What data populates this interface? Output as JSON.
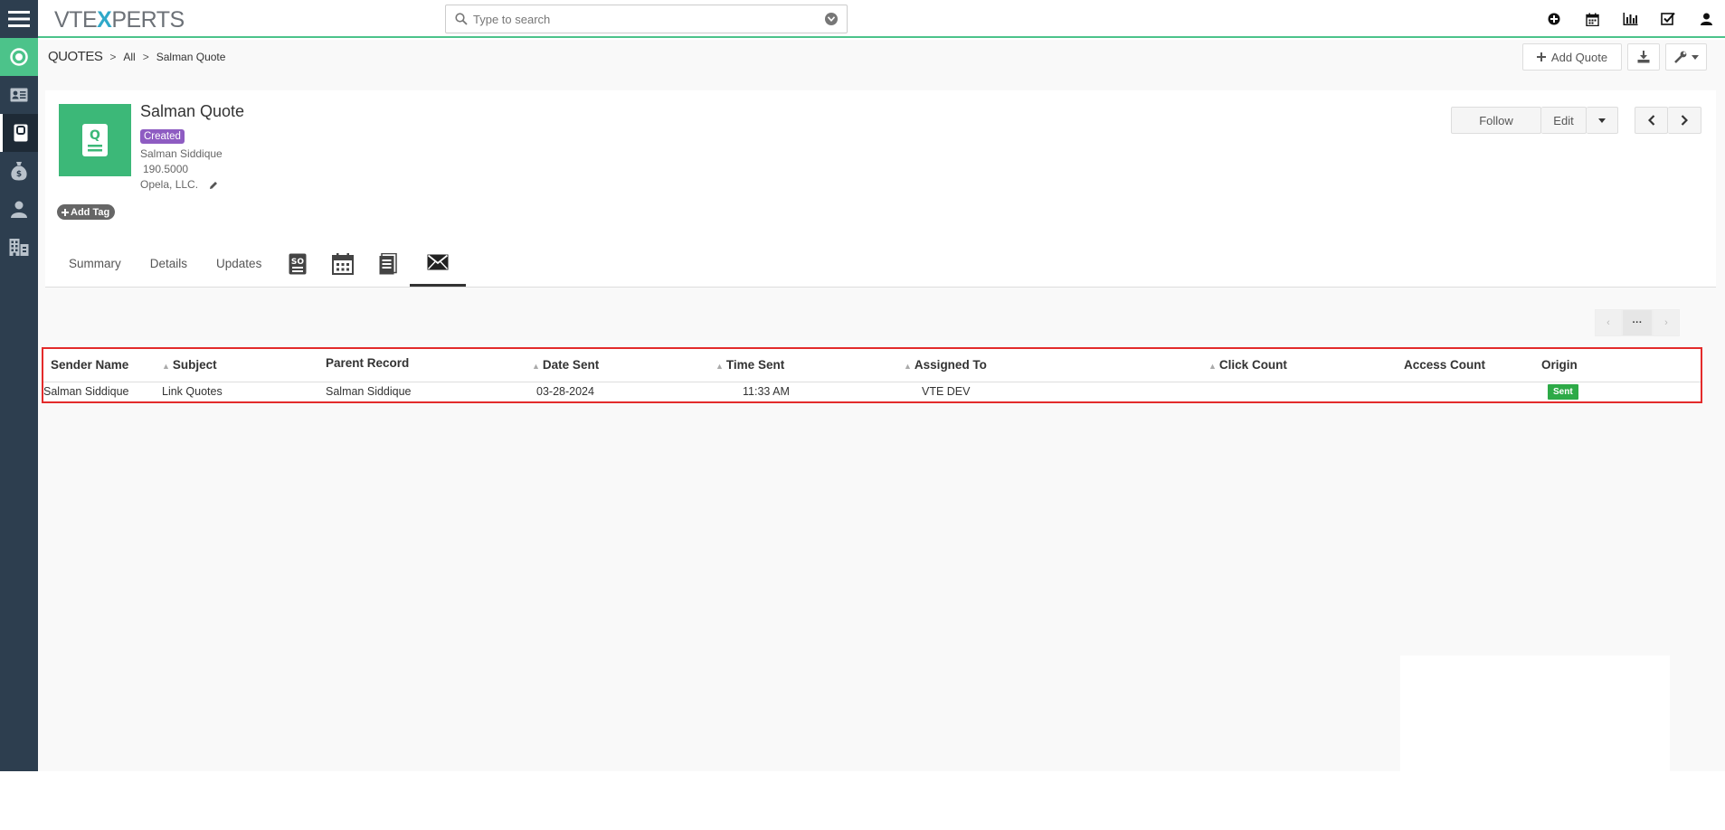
{
  "topbar": {
    "logo_prefix": "VTE",
    "logo_x": "X",
    "logo_suffix": "PERTS",
    "search_placeholder": "Type to search",
    "icons": [
      "plus-circle-icon",
      "calendar-icon",
      "bar-chart-icon",
      "checkbox-icon",
      "user-icon"
    ]
  },
  "sidebar": {
    "items": [
      "home-icon",
      "contact-card-icon",
      "quotes-icon",
      "money-bag-icon",
      "person-icon",
      "organization-icon"
    ]
  },
  "breadcrumb": {
    "module": "QUOTES",
    "filter": "All",
    "record": "Salman Quote"
  },
  "header_actions": {
    "add_label": "Add Quote"
  },
  "record": {
    "title": "Salman Quote",
    "status": "Created",
    "owner": "Salman Siddique",
    "amount": "190.5000",
    "organization": "Opela, LLC.",
    "add_tag": "Add Tag"
  },
  "record_actions": {
    "follow": "Follow",
    "edit": "Edit"
  },
  "tabs": {
    "summary": "Summary",
    "details": "Details",
    "updates": "Updates"
  },
  "pager": {
    "more": "···"
  },
  "table": {
    "headers": {
      "sender_name": "Sender Name",
      "subject": "Subject",
      "parent_record": "Parent Record",
      "date_sent": "Date Sent",
      "time_sent": "Time Sent",
      "assigned_to": "Assigned To",
      "click_count": "Click Count",
      "access_count": "Access Count",
      "origin": "Origin"
    },
    "rows": [
      {
        "sender_name": "Salman Siddique",
        "subject": "Link Quotes",
        "parent_record": "Salman Siddique",
        "date_sent": "03-28-2024",
        "time_sent": "11:33 AM",
        "assigned_to": "VTE DEV",
        "click_count": "",
        "access_count": "",
        "origin": "Sent"
      }
    ]
  },
  "colors": {
    "sidebar_bg": "#2d3e4f",
    "accent_green": "#4cc38a",
    "status_purple": "#8e5cc2",
    "sent_green": "#2daa47",
    "highlight_red": "#e32b2b"
  }
}
